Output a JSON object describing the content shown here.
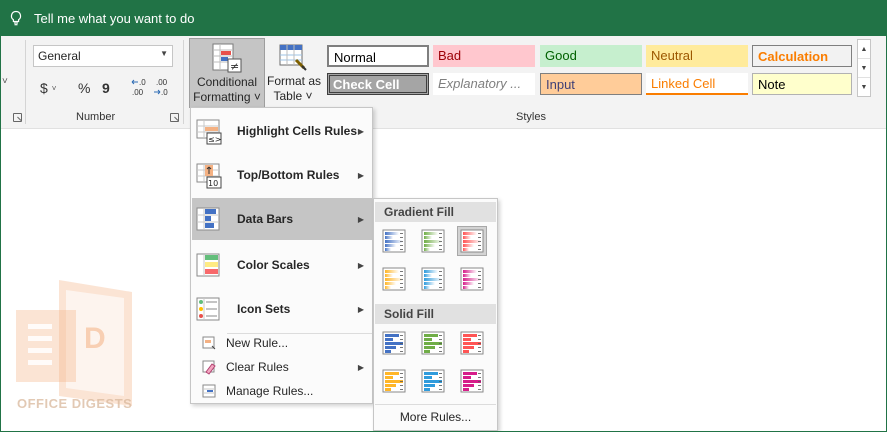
{
  "tellme": {
    "text": "Tell me what you want to do"
  },
  "number_group": {
    "format_value": "General",
    "currency": "$",
    "percent": "%",
    "comma": "9",
    "inc_decimal": "←0 .00",
    "dec_decimal": ".00 →0",
    "label": "Number"
  },
  "conditional_formatting": {
    "line1": "Conditional",
    "line2": "Formatting ˅"
  },
  "format_table": {
    "line1": "Format as",
    "line2": "Table ˅"
  },
  "styles_group": {
    "label": "Styles",
    "cells": [
      {
        "name": "Normal",
        "bg": "#ffffff",
        "fg": "#000000"
      },
      {
        "name": "Bad",
        "bg": "#ffc7ce",
        "fg": "#9c0006"
      },
      {
        "name": "Good",
        "bg": "#c6efce",
        "fg": "#006100"
      },
      {
        "name": "Neutral",
        "bg": "#ffeb9c",
        "fg": "#9c5700"
      },
      {
        "name": "Calculation",
        "bg": "#f2f2f2",
        "fg": "#fa7d00"
      },
      {
        "name": "Check Cell",
        "bg": "#a5a5a5",
        "fg": "#ffffff"
      },
      {
        "name": "Explanatory ...",
        "bg": "#ffffff",
        "fg": "#7f7f7f"
      },
      {
        "name": "Input",
        "bg": "#ffcc99",
        "fg": "#3f3f76"
      },
      {
        "name": "Linked Cell",
        "bg": "#ffffff",
        "fg": "#fa7d00"
      },
      {
        "name": "Note",
        "bg": "#ffffcc",
        "fg": "#000000"
      }
    ]
  },
  "menu": {
    "items": [
      {
        "label": "Highlight Cells Rules",
        "icon": "highlight-cells-icon"
      },
      {
        "label": "Top/Bottom Rules",
        "icon": "top-bottom-icon"
      },
      {
        "label": "Data Bars",
        "icon": "data-bars-icon"
      },
      {
        "label": "Color Scales",
        "icon": "color-scales-icon"
      },
      {
        "label": "Icon Sets",
        "icon": "icon-sets-icon"
      },
      {
        "label": "New Rule...",
        "icon": "new-rule-icon"
      },
      {
        "label": "Clear Rules",
        "icon": "clear-rules-icon"
      },
      {
        "label": "Manage Rules...",
        "icon": "manage-rules-icon"
      }
    ]
  },
  "submenu": {
    "gradient_label": "Gradient Fill",
    "solid_label": "Solid Fill",
    "more_rules": "More Rules...",
    "gradient_colors": [
      "#4472c4",
      "#70ad47",
      "#ff5555",
      "#ffb628",
      "#2f9bdc",
      "#d61e8a"
    ],
    "solid_colors": [
      "#4472c4",
      "#70ad47",
      "#ff5555",
      "#ffb628",
      "#2f9bdc",
      "#d61e8a"
    ]
  },
  "watermark": {
    "text": "OFFICE DIGESTS"
  }
}
